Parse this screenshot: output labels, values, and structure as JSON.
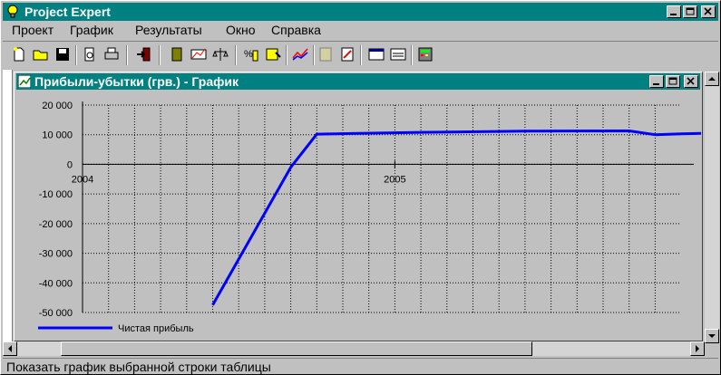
{
  "app": {
    "title": "Project Expert"
  },
  "menu": [
    "Проект",
    "График",
    "Результаты",
    "Окно",
    "Справка"
  ],
  "toolbar_icons": [
    "new-document-icon",
    "open-folder-icon",
    "save-icon",
    "print-preview-icon",
    "print-icon",
    "exit-icon",
    "book-icon",
    "chart-cf-icon",
    "scales-icon",
    "percent-chart-icon",
    "edit-table-icon",
    "line-chart-icon",
    "report-icon",
    "report-chart-icon",
    "list-window-icon",
    "table-window-icon",
    "calculator-icon"
  ],
  "child_window": {
    "title": "Прибыли-убытки (грв.) - График"
  },
  "chart_data": {
    "type": "line",
    "x_tick_labels": [
      "2004",
      "2005"
    ],
    "y_tick_labels": [
      "20 000",
      "10 000",
      "0",
      "-10 000",
      "-20 000",
      "-30 000",
      "-40 000",
      "-50 000"
    ],
    "ylim": [
      -50000,
      20000
    ],
    "grid": true,
    "legend_position": "bottom-left",
    "series": [
      {
        "name": "Чистая прибыль",
        "color": "#0000ff",
        "points": [
          [
            "2004-06",
            -47500
          ],
          [
            "2004-09",
            -1000
          ],
          [
            "2004-10",
            10200
          ],
          [
            "2005-02",
            10800
          ],
          [
            "2005-06",
            11200
          ],
          [
            "2005-10",
            11300
          ],
          [
            "2005-11",
            10000
          ],
          [
            "2005-12",
            10300
          ],
          [
            "2006-01",
            10500
          ]
        ]
      }
    ]
  },
  "status": {
    "text": "Показать график выбранной строки таблицы"
  }
}
